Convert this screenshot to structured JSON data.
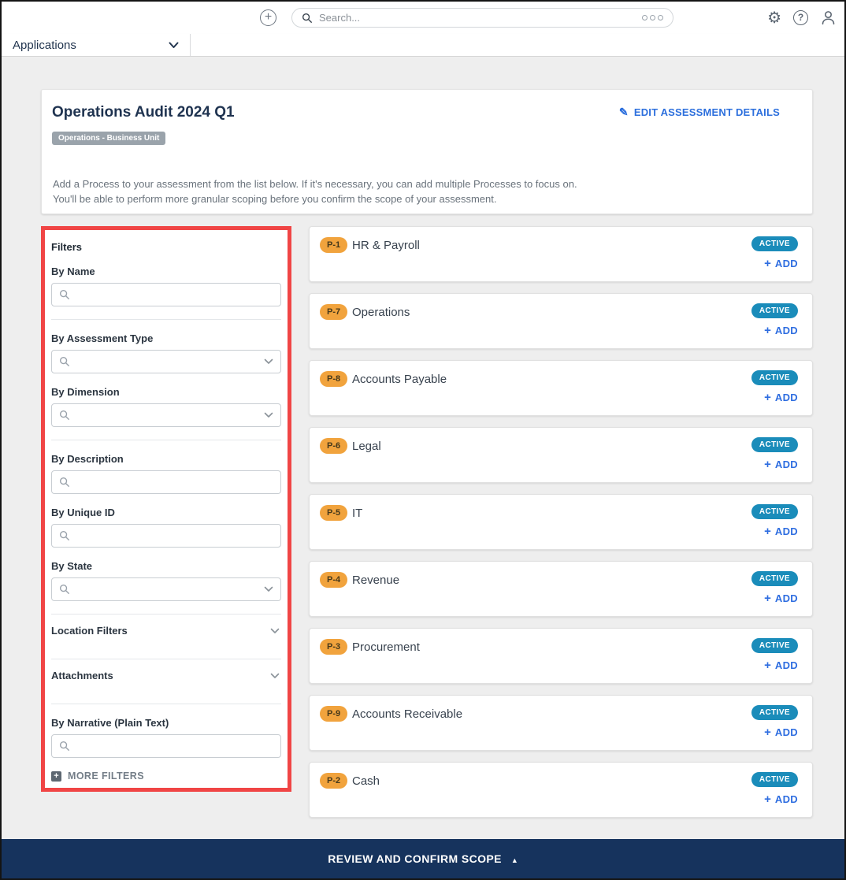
{
  "topbar": {
    "search_placeholder": "Search..."
  },
  "nav": {
    "applications_label": "Applications"
  },
  "assessment": {
    "title": "Operations Audit 2024 Q1",
    "type_badge": "Operations - Business Unit",
    "edit_link": "EDIT ASSESSMENT DETAILS",
    "description_line1": "Add a Process to your assessment from the list below. If it's necessary, you can add multiple Processes to focus on.",
    "description_line2": "You'll be able to perform more granular scoping before you confirm the scope of your assessment."
  },
  "filters": {
    "heading": "Filters",
    "items": [
      {
        "type": "field",
        "label": "By Name",
        "dropdown": false,
        "divider_after": true
      },
      {
        "type": "field",
        "label": "By Assessment Type",
        "dropdown": true,
        "divider_after": false
      },
      {
        "type": "field",
        "label": "By Dimension",
        "dropdown": true,
        "divider_after": true
      },
      {
        "type": "field",
        "label": "By Description",
        "dropdown": false,
        "divider_after": false
      },
      {
        "type": "field",
        "label": "By Unique ID",
        "dropdown": false,
        "divider_after": false
      },
      {
        "type": "field",
        "label": "By State",
        "dropdown": true,
        "divider_after": true
      },
      {
        "type": "collapsible",
        "label": "Location Filters",
        "divider_after": true
      },
      {
        "type": "collapsible",
        "label": "Attachments",
        "divider_after": true
      },
      {
        "type": "field",
        "label": "By Narrative (Plain Text)",
        "dropdown": false,
        "divider_after": false
      }
    ],
    "more_filters_label": "MORE FILTERS"
  },
  "processes": [
    {
      "id": "P-1",
      "name": "HR & Payroll",
      "status": "ACTIVE",
      "add_label": "ADD"
    },
    {
      "id": "P-7",
      "name": "Operations",
      "status": "ACTIVE",
      "add_label": "ADD"
    },
    {
      "id": "P-8",
      "name": "Accounts Payable",
      "status": "ACTIVE",
      "add_label": "ADD"
    },
    {
      "id": "P-6",
      "name": "Legal",
      "status": "ACTIVE",
      "add_label": "ADD"
    },
    {
      "id": "P-5",
      "name": "IT",
      "status": "ACTIVE",
      "add_label": "ADD"
    },
    {
      "id": "P-4",
      "name": "Revenue",
      "status": "ACTIVE",
      "add_label": "ADD"
    },
    {
      "id": "P-3",
      "name": "Procurement",
      "status": "ACTIVE",
      "add_label": "ADD"
    },
    {
      "id": "P-9",
      "name": "Accounts Receivable",
      "status": "ACTIVE",
      "add_label": "ADD"
    },
    {
      "id": "P-2",
      "name": "Cash",
      "status": "ACTIVE",
      "add_label": "ADD"
    }
  ],
  "footer": {
    "label": "REVIEW AND CONFIRM SCOPE"
  },
  "icons": {
    "plus_glyph": "+",
    "pencil_glyph": "✎",
    "gear_glyph": "⚙",
    "help_glyph": "?",
    "collapse_triangle_glyph": "▲"
  },
  "colors": {
    "accent_blue": "#2c6fdd",
    "badge_orange": "#f1a33d",
    "status_teal": "#1a8cba",
    "footer_navy": "#16335d",
    "annotation_red": "#f04545",
    "type_badge_gray": "#9aa3ab"
  }
}
